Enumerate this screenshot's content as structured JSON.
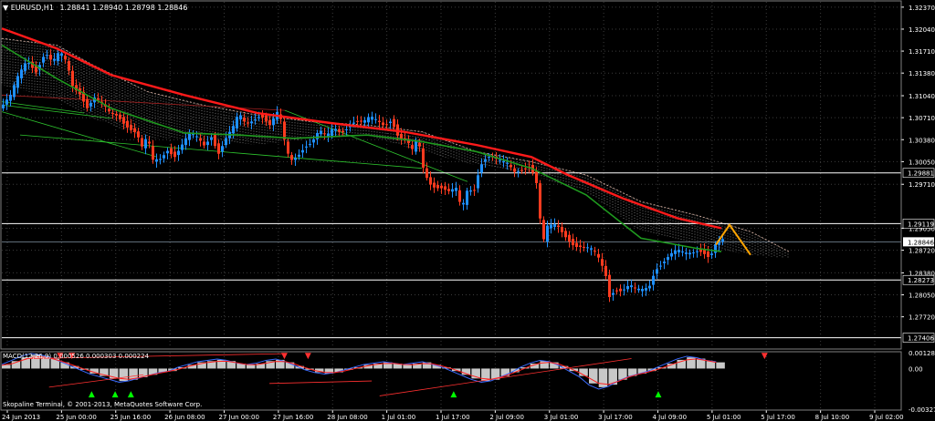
{
  "chart_data": [
    {
      "type": "candlestick",
      "symbol_label": "EURUSD,H1",
      "ohlc_header": "1.28841 1.28940 1.28798 1.28846",
      "ylim": [
        1.2725,
        1.3245
      ],
      "y_ticks": [
        "1.32370",
        "1.32040",
        "1.31710",
        "1.31380",
        "1.31040",
        "1.30710",
        "1.30380",
        "1.30050",
        "1.29710",
        "1.29050",
        "1.28720",
        "1.28380",
        "1.28050",
        "1.27720"
      ],
      "x_ticks": [
        "24 Jun 2013",
        "25 Jun 00:00",
        "25 Jun 16:00",
        "26 Jun 08:00",
        "27 Jun 00:00",
        "27 Jun 16:00",
        "28 Jun 08:00",
        "1 Jul 01:00",
        "1 Jul 17:00",
        "2 Jul 09:00",
        "3 Jul 01:00",
        "3 Jul 17:00",
        "4 Jul 09:00",
        "5 Jul 01:00",
        "5 Jul 17:00",
        "8 Jul 10:00",
        "9 Jul 02:00"
      ],
      "horizontal_levels": [
        {
          "value": 1.29881,
          "label": "1.29881"
        },
        {
          "value": 1.29119,
          "label": "1.29119"
        },
        {
          "value": 1.28273,
          "label": "1.28273"
        },
        {
          "value": 1.27406,
          "label": "1.27406"
        }
      ],
      "current_price": {
        "value": 1.28846,
        "label": "1.28846"
      },
      "price_path": [
        [
          0,
          1.3085
        ],
        [
          12,
          1.3102
        ],
        [
          20,
          1.313
        ],
        [
          30,
          1.3158
        ],
        [
          40,
          1.3143
        ],
        [
          50,
          1.317
        ],
        [
          58,
          1.3152
        ],
        [
          66,
          1.3168
        ],
        [
          74,
          1.3152
        ],
        [
          80,
          1.312
        ],
        [
          88,
          1.311
        ],
        [
          96,
          1.3088
        ],
        [
          104,
          1.31
        ],
        [
          112,
          1.309
        ],
        [
          120,
          1.3078
        ],
        [
          130,
          1.3075
        ],
        [
          140,
          1.306
        ],
        [
          150,
          1.3048
        ],
        [
          156,
          1.3025
        ],
        [
          162,
          1.304
        ],
        [
          168,
          1.3005
        ],
        [
          176,
          1.301
        ],
        [
          184,
          1.3025
        ],
        [
          192,
          1.3015
        ],
        [
          200,
          1.303
        ],
        [
          208,
          1.3045
        ],
        [
          216,
          1.304
        ],
        [
          224,
          1.303
        ],
        [
          232,
          1.3045
        ],
        [
          240,
          1.302
        ],
        [
          248,
          1.304
        ],
        [
          256,
          1.3055
        ],
        [
          262,
          1.3075
        ],
        [
          270,
          1.306
        ],
        [
          278,
          1.307
        ],
        [
          286,
          1.3078
        ],
        [
          296,
          1.306
        ],
        [
          306,
          1.308
        ],
        [
          312,
          1.3035
        ],
        [
          318,
          1.3005
        ],
        [
          326,
          1.3015
        ],
        [
          334,
          1.303
        ],
        [
          342,
          1.3035
        ],
        [
          350,
          1.305
        ],
        [
          358,
          1.304
        ],
        [
          366,
          1.3055
        ],
        [
          374,
          1.305
        ],
        [
          382,
          1.306
        ],
        [
          390,
          1.3068
        ],
        [
          398,
          1.3062
        ],
        [
          406,
          1.307
        ],
        [
          414,
          1.3065
        ],
        [
          422,
          1.306
        ],
        [
          430,
          1.3072
        ],
        [
          434,
          1.305
        ],
        [
          440,
          1.304
        ],
        [
          446,
          1.3035
        ],
        [
          452,
          1.302
        ],
        [
          458,
          1.304
        ],
        [
          464,
          1.2995
        ],
        [
          470,
          1.2975
        ],
        [
          476,
          1.297
        ],
        [
          484,
          1.2968
        ],
        [
          492,
          1.296
        ],
        [
          500,
          1.2962
        ],
        [
          506,
          1.293
        ],
        [
          512,
          1.296
        ],
        [
          520,
          1.2965
        ],
        [
          526,
          1.3
        ],
        [
          530,
          1.301
        ],
        [
          538,
          1.3015
        ],
        [
          546,
          1.3005
        ],
        [
          556,
          1.3
        ],
        [
          564,
          1.299
        ],
        [
          572,
          1.2995
        ],
        [
          580,
          1.3
        ],
        [
          586,
          1.2985
        ],
        [
          590,
          1.296
        ],
        [
          594,
          1.2875
        ],
        [
          600,
          1.2905
        ],
        [
          610,
          1.291
        ],
        [
          620,
          1.2895
        ],
        [
          630,
          1.288
        ],
        [
          640,
          1.2875
        ],
        [
          650,
          1.287
        ],
        [
          658,
          1.2855
        ],
        [
          664,
          1.2835
        ],
        [
          668,
          1.2805
        ],
        [
          674,
          1.2815
        ],
        [
          682,
          1.2812
        ],
        [
          690,
          1.2818
        ],
        [
          698,
          1.281
        ],
        [
          706,
          1.2812
        ],
        [
          712,
          1.282
        ],
        [
          718,
          1.2845
        ],
        [
          726,
          1.2855
        ],
        [
          734,
          1.2865
        ],
        [
          742,
          1.287
        ],
        [
          750,
          1.2865
        ],
        [
          758,
          1.2868
        ],
        [
          766,
          1.2875
        ],
        [
          772,
          1.287
        ],
        [
          778,
          1.2862
        ],
        [
          784,
          1.288
        ],
        [
          788,
          1.2885
        ]
      ],
      "moving_average_red": [
        [
          0,
          1.3205
        ],
        [
          60,
          1.3175
        ],
        [
          120,
          1.3135
        ],
        [
          200,
          1.3105
        ],
        [
          280,
          1.3078
        ],
        [
          360,
          1.3063
        ],
        [
          440,
          1.305
        ],
        [
          520,
          1.303
        ],
        [
          580,
          1.3012
        ],
        [
          620,
          1.2985
        ],
        [
          680,
          1.295
        ],
        [
          740,
          1.292
        ],
        [
          788,
          1.2905
        ]
      ],
      "moving_average_green": [
        [
          0,
          1.318
        ],
        [
          60,
          1.313
        ],
        [
          120,
          1.3085
        ],
        [
          200,
          1.3048
        ],
        [
          260,
          1.3045
        ],
        [
          320,
          1.304
        ],
        [
          400,
          1.3045
        ],
        [
          460,
          1.3035
        ],
        [
          520,
          1.302
        ],
        [
          580,
          1.2995
        ],
        [
          640,
          1.2955
        ],
        [
          700,
          1.289
        ],
        [
          760,
          1.2875
        ],
        [
          788,
          1.287
        ]
      ],
      "orange_zigzag": [
        [
          782,
          1.288
        ],
        [
          797,
          1.291
        ],
        [
          820,
          1.2865
        ]
      ],
      "ichimoku_cloud_upper": [
        [
          0,
          1.319
        ],
        [
          60,
          1.318
        ],
        [
          100,
          1.315
        ],
        [
          160,
          1.311
        ],
        [
          220,
          1.309
        ],
        [
          280,
          1.3075
        ],
        [
          340,
          1.3065
        ],
        [
          400,
          1.306
        ],
        [
          460,
          1.305
        ],
        [
          520,
          1.302
        ],
        [
          580,
          1.3005
        ],
        [
          640,
          1.2985
        ],
        [
          700,
          1.2945
        ],
        [
          760,
          1.2925
        ],
        [
          820,
          1.29
        ],
        [
          862,
          1.287
        ]
      ],
      "ichimoku_cloud_lower": [
        [
          0,
          1.312
        ],
        [
          60,
          1.31
        ],
        [
          100,
          1.307
        ],
        [
          160,
          1.304
        ],
        [
          220,
          1.304
        ],
        [
          280,
          1.303
        ],
        [
          340,
          1.304
        ],
        [
          400,
          1.3045
        ],
        [
          460,
          1.302
        ],
        [
          520,
          1.3
        ],
        [
          580,
          1.2985
        ],
        [
          640,
          1.296
        ],
        [
          700,
          1.29
        ],
        [
          760,
          1.288
        ],
        [
          820,
          1.2865
        ],
        [
          862,
          1.286
        ]
      ]
    },
    {
      "type": "macd",
      "label": "MACD(12,26,9) 0.000526 0.000303 0.000224",
      "ylim": [
        -0.00327,
        0.00128
      ],
      "y_ticks": [
        "0.00128",
        "0.00",
        "-0.00327"
      ],
      "histogram": [
        0.0003,
        0.0006,
        0.0009,
        0.0011,
        0.001,
        0.0008,
        0.0005,
        0.0002,
        -0.0001,
        -0.0004,
        -0.0006,
        -0.0008,
        -0.001,
        -0.0009,
        -0.0007,
        -0.0005,
        -0.0003,
        -0.0002,
        0.0001,
        0.0003,
        0.0005,
        0.0006,
        0.0007,
        0.0006,
        0.0004,
        0.0003,
        0.0004,
        0.0006,
        0.0007,
        0.0005,
        0.0002,
        -0.0001,
        -0.0003,
        -0.0004,
        -0.0003,
        -0.0001,
        0.0001,
        0.0003,
        0.0004,
        0.0005,
        0.0004,
        0.0003,
        0.0004,
        0.0005,
        0.0003,
        0.0001,
        -0.0002,
        -0.0005,
        -0.0008,
        -0.001,
        -0.0009,
        -0.0006,
        -0.0003,
        0.0001,
        0.0004,
        0.0006,
        0.0005,
        0.0002,
        -0.0002,
        -0.0006,
        -0.0012,
        -0.0015,
        -0.0013,
        -0.0009,
        -0.0006,
        -0.0004,
        -0.0002,
        0.0001,
        0.0004,
        0.0007,
        0.0009,
        0.0008,
        0.0006,
        0.0005
      ],
      "signal_arrows": [
        {
          "x_frac": 0.07,
          "dir": "down",
          "color": "#ff3030"
        },
        {
          "x_frac": 0.085,
          "dir": "down",
          "color": "#ff3030"
        },
        {
          "x_frac": 0.11,
          "dir": "up",
          "color": "#00ff00"
        },
        {
          "x_frac": 0.14,
          "dir": "up",
          "color": "#00ff00"
        },
        {
          "x_frac": 0.16,
          "dir": "up",
          "color": "#00ff00"
        },
        {
          "x_frac": 0.355,
          "dir": "down",
          "color": "#ff3030"
        },
        {
          "x_frac": 0.385,
          "dir": "down",
          "color": "#ff3030"
        },
        {
          "x_frac": 0.57,
          "dir": "up",
          "color": "#00ff00"
        },
        {
          "x_frac": 0.83,
          "dir": "up",
          "color": "#00ff00"
        },
        {
          "x_frac": 0.965,
          "dir": "down",
          "color": "#ff3030"
        }
      ]
    }
  ],
  "footer_text": "Skopaline Terminal, © 2001-2013, MetaQuotes Software Corp.",
  "colors": {
    "background": "#000000",
    "grid": "#3c3c3c",
    "axis_text": "#ffffff",
    "bull_candle": "#1e90ff",
    "bear_candle": "#ff3b1f",
    "ma_red": "#ff1a1a",
    "ma_green": "#1f9a1f",
    "cloud": "#ffffff",
    "zigzag": "#ffa500",
    "level_line": "#ffffff",
    "macd_hist": "#c8c8c8",
    "macd_main": "#3a6bff",
    "macd_signal": "#ff2020"
  }
}
